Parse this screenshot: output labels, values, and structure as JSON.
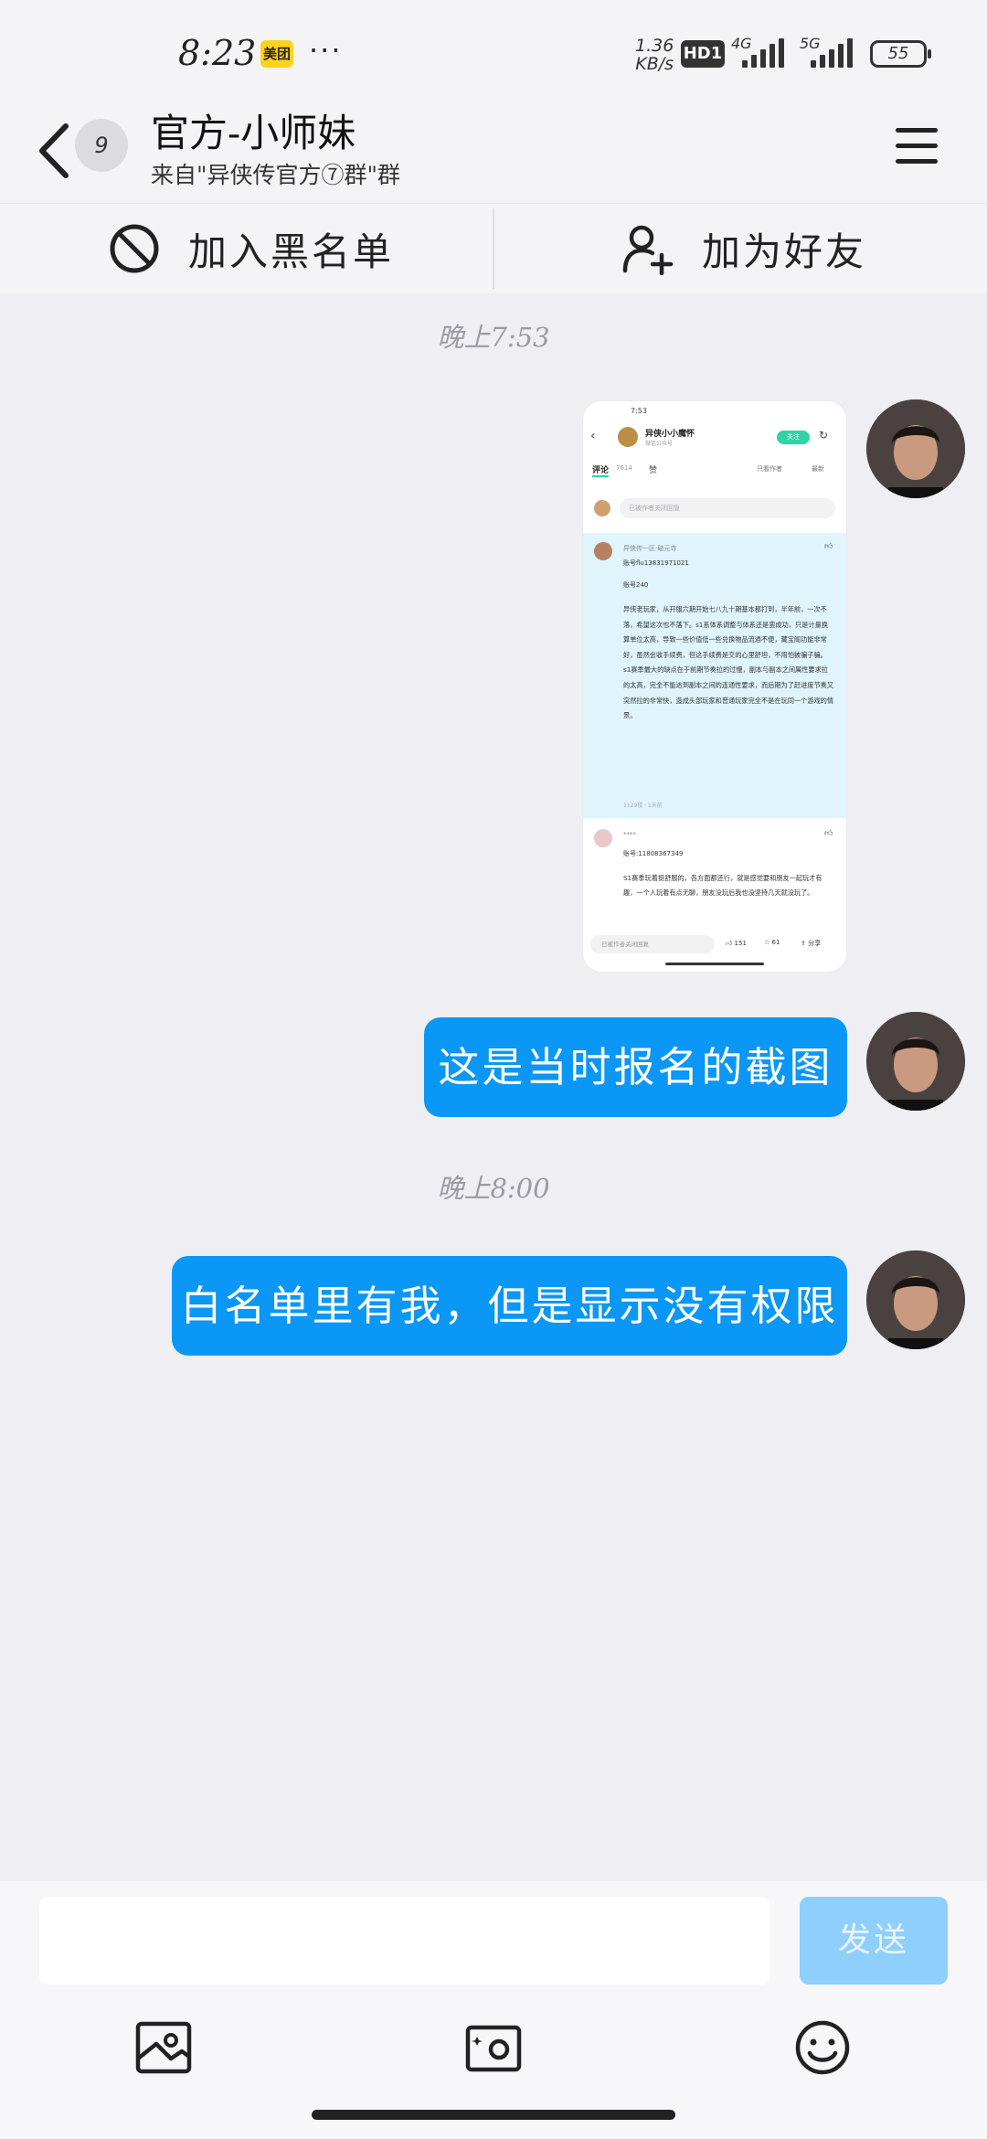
{
  "status_bar": {
    "time": "8:23",
    "app_badge": "美团",
    "more_dots": "···",
    "net_speed_value": "1.36",
    "net_speed_unit": "KB/s",
    "hd_label": "HD1",
    "sim1_label": "4G",
    "sim2_label": "5G",
    "battery": "55"
  },
  "header": {
    "unread_count": "9",
    "title": "官方-小师妹",
    "subtitle": "来自\"异侠传官方⑦群\"群"
  },
  "actions": {
    "block_label": "加入黑名单",
    "add_friend_label": "加为好友"
  },
  "messages": [
    {
      "type": "timestamp",
      "text": "晚上7:53"
    },
    {
      "type": "image",
      "from": "me"
    },
    {
      "type": "text",
      "from": "me",
      "text": "这是当时报名的截图"
    },
    {
      "type": "timestamp",
      "text": "晚上8:00"
    },
    {
      "type": "text",
      "from": "me",
      "text": "白名单里有我，但是显示没有权限"
    }
  ],
  "screenshot": {
    "time": "7:53",
    "user": "异侠小小魔怀",
    "user_sub": "微信公众号",
    "follow": "关注",
    "tab_comments": "评论",
    "tab_comments_count": "7614",
    "tab_likes": "赞",
    "option_author": "只看作者",
    "option_latest": "最新",
    "comment_placeholder": "已被作者关闭回复",
    "c1_name": "异侠传一区-破元寺",
    "c1_account": "账号flu13831971021",
    "c1_level": "账号240",
    "c1_body": "异侠老玩家，从开服六期开始七八九十期基本都打到，半年前，一次不落，希望这次也不落下。s1系体系调整与体系还是蛮成功，只是计量换算单位太高，导致一些价值低一些兑换物品流通不便，藏宝阁功能非常好，虽然会收手续费，但这手续费是交的心里舒坦，不用怕被骗子骗。s1赛季最大的缺点在于前期节奏拉的过慢，副本与副本之间属性要求拉的太高，完全不能达到副本之间的连通性要求，而后期为了赶进度节奏又突然拉的非常快，造成头部玩家和普通玩家完全不是在玩同一个游戏的情景。",
    "c1_meta": "1129楼 · 1天前",
    "c2_name": "****",
    "c2_account": "账号:11808367349",
    "c2_body": "S1赛季玩着挺舒服的，各方面都还行，就是感觉要和朋友一起玩才有趣，一个人玩着有点无聊，朋友没玩后我也没坚持几天就没玩了。",
    "footer_placeholder": "已被作者关闭回复",
    "like_count": "151",
    "star_count": "61",
    "share_label": "分享"
  },
  "input_bar": {
    "placeholder": "",
    "send_label": "发送"
  },
  "colors": {
    "bubble": "#0b97f5",
    "send_disabled": "#8fcffb",
    "background": "#eeeef3"
  }
}
